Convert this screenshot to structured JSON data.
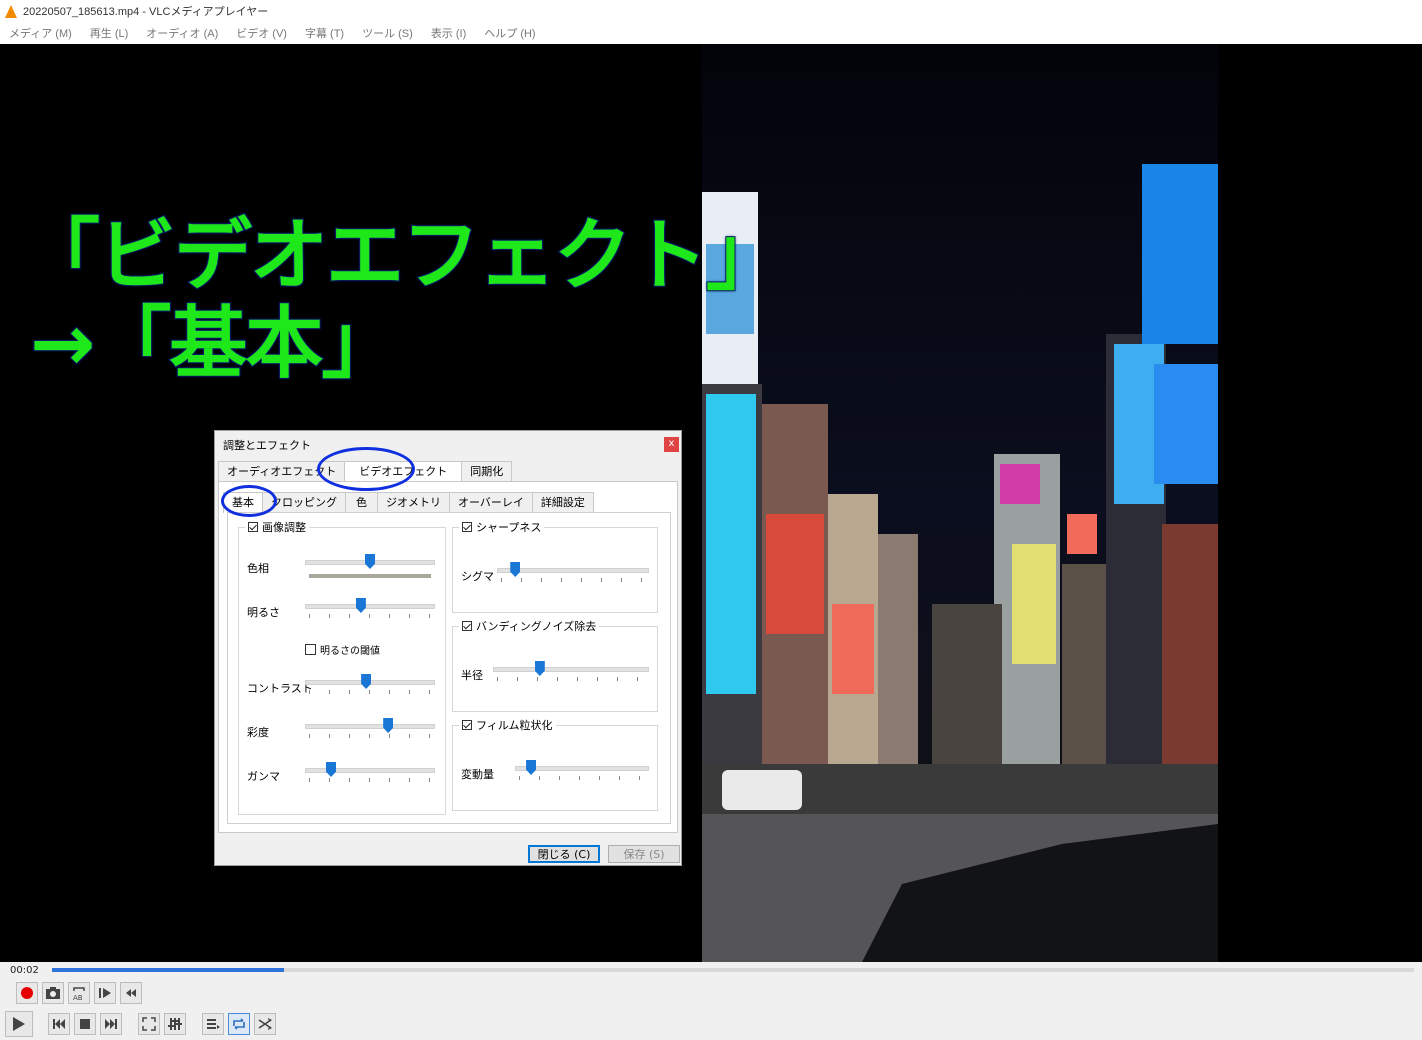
{
  "window": {
    "title": "20220507_185613.mp4 - VLCメディアプレイヤー"
  },
  "menu": [
    "メディア (M)",
    "再生 (L)",
    "オーディオ (A)",
    "ビデオ (V)",
    "字幕 (T)",
    "ツール (S)",
    "表示 (I)",
    "ヘルプ (H)"
  ],
  "overlay": {
    "line1": "「ビデオエフェクト」",
    "line2": "→「基本」",
    "color": "#1ee81a"
  },
  "dialog": {
    "title": "調整とエフェクト",
    "close": "x",
    "tabs": [
      "オーディオエフェクト",
      "ビデオエフェクト",
      "同期化"
    ],
    "subtabs": [
      "基本",
      "クロッピング",
      "色",
      "ジオメトリ",
      "オーバーレイ",
      "詳細設定"
    ],
    "image_adjust": {
      "label": "画像調整",
      "checked": true,
      "hue": {
        "label": "色相",
        "value": 0.5
      },
      "brightness": {
        "label": "明るさ",
        "value": 0.43
      },
      "brightness_threshold": {
        "label": "明るさの閾値",
        "checked": false
      },
      "contrast": {
        "label": "コントラスト",
        "value": 0.47
      },
      "saturation": {
        "label": "彩度",
        "value": 0.64
      },
      "gamma": {
        "label": "ガンマ",
        "value": 0.2
      }
    },
    "sharpen": {
      "label": "シャープネス",
      "checked": true,
      "sigma": {
        "label": "シグマ",
        "value": 0.12
      }
    },
    "banding": {
      "label": "バンディングノイズ除去",
      "checked": true,
      "radius": {
        "label": "半径",
        "value": 0.3
      }
    },
    "grain": {
      "label": "フィルム粒状化",
      "checked": true,
      "variance": {
        "label": "変動量",
        "value": 0.12
      }
    },
    "close_button": "閉じる (C)",
    "save_button": "保存 (S)"
  },
  "player": {
    "time": "00:02",
    "progress": 0.17,
    "accent": "#2e73d9"
  }
}
